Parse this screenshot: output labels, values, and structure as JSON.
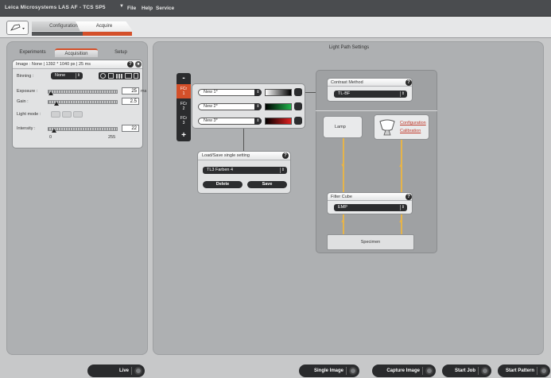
{
  "title_bar": {
    "app_title": "Leica Microsystems LAS AF  -  TCS SP5",
    "menu": [
      "File",
      "Help",
      "Service"
    ]
  },
  "workflow_tabs": {
    "configuration": "Configuration",
    "acquire": "Acquire"
  },
  "left_panel": {
    "tabs": [
      "Experiments",
      "Acquisition",
      "Setup"
    ],
    "image_info": "Image :  None | 1392 * 1040 px | 25 ms",
    "binning": {
      "label": "Binning :",
      "value": "None"
    },
    "exposure": {
      "label": "Exposure :",
      "value": "25",
      "unit": "ms",
      "level": 0.05
    },
    "gain": {
      "label": "Gain :",
      "value": "2.5",
      "level": 0.12
    },
    "light_mode": {
      "label": "Light mode :",
      "buttons": [
        "",
        "",
        ""
      ]
    },
    "intensity": {
      "label": "Intensity :",
      "value": "22",
      "min": "0",
      "max": "255",
      "level": 0.09
    }
  },
  "right_panel": {
    "title": "Light Path Settings",
    "fcr": {
      "minus": "-",
      "plus": "+",
      "items": [
        {
          "line1": "FCr",
          "line2": "1",
          "setting": "New 1*"
        },
        {
          "line1": "FCr",
          "line2": "2",
          "setting": "New 2*"
        },
        {
          "line1": "FCr",
          "line2": "3",
          "setting": "New 3*"
        }
      ]
    },
    "load_save": {
      "title": "Load/Save single setting",
      "value": "TL3 Farben 4",
      "delete": "Delete",
      "save": "Save"
    },
    "contrast_method": {
      "title": "Contrast Method",
      "value": "TL-BF"
    },
    "lamp": "Lamp",
    "camera_links": [
      "Configuration",
      "Calibration"
    ],
    "filter_cube": {
      "title": "Filter Cube",
      "value": "EMP"
    },
    "specimen": "Specimen"
  },
  "bottom_bar": {
    "live": "Live",
    "single_image": "Single Image",
    "capture_image": "Capture Image",
    "start_job": "Start Job",
    "start_pattern": "Start Pattern"
  },
  "colors": {
    "accent": "#d4502a",
    "wire": "#e6b44a",
    "dark": "#2c2d2f"
  }
}
